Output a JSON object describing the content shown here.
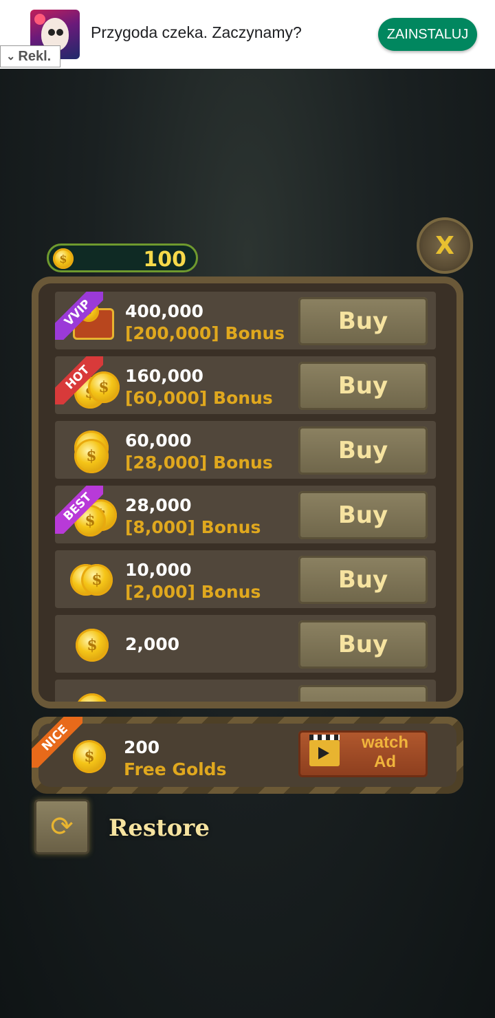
{
  "ad": {
    "text": "Przygoda czeka. Zaczynamy?",
    "install_label": "ZAINSTALUJ",
    "tag_label": "Rekl.",
    "tag_chevron": "⌄"
  },
  "balance": {
    "value": "100",
    "coin_symbol": "$"
  },
  "close": {
    "label": "X"
  },
  "offers": [
    {
      "badge": "VVIP",
      "badge_color": "#9b3ad8",
      "amount": "400,000",
      "bonus": "[200,000] Bonus",
      "buy_label": "Buy",
      "icon": "treasure-chest-icon"
    },
    {
      "badge": "HOT",
      "badge_color": "#d83a3a",
      "amount": "160,000",
      "bonus": "[60,000] Bonus",
      "buy_label": "Buy",
      "icon": "coin-pile-icon"
    },
    {
      "badge": "",
      "badge_color": "",
      "amount": "60,000",
      "bonus": "[28,000] Bonus",
      "buy_label": "Buy",
      "icon": "coin-stack-icon"
    },
    {
      "badge": "BEST",
      "badge_color": "#b83ad8",
      "amount": "28,000",
      "bonus": "[8,000] Bonus",
      "buy_label": "Buy",
      "icon": "coin-pair-icon"
    },
    {
      "badge": "",
      "badge_color": "",
      "amount": "10,000",
      "bonus": "[2,000] Bonus",
      "buy_label": "Buy",
      "icon": "two-coins-icon"
    },
    {
      "badge": "",
      "badge_color": "",
      "amount": "2,000",
      "bonus": "",
      "buy_label": "Buy",
      "icon": "coin-icon"
    }
  ],
  "free_offer": {
    "badge": "NICE",
    "amount": "200",
    "label": "Free Golds",
    "watch_line1": "watch",
    "watch_line2": "Ad"
  },
  "restore": {
    "label": "Restore",
    "icon_glyph": "⟳"
  }
}
